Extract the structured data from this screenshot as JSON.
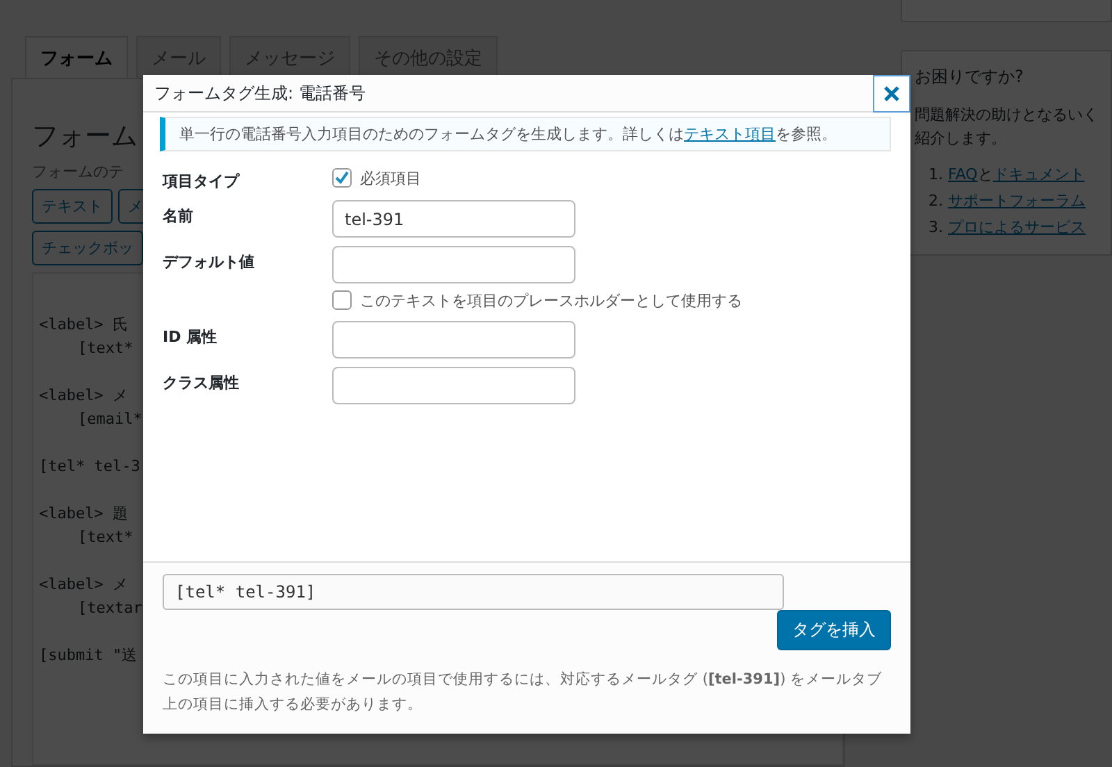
{
  "tabs": [
    {
      "label": "フォーム",
      "selected": true
    },
    {
      "label": "メール",
      "selected": false
    },
    {
      "label": "メッセージ",
      "selected": false
    },
    {
      "label": "その他の設定",
      "selected": false
    }
  ],
  "form_panel": {
    "title": "フォーム",
    "description": "フォームのテ",
    "tag_buttons": [
      [
        "テキスト",
        "メ"
      ],
      [
        "チェックボッ"
      ]
    ],
    "code_blocks": [
      {
        "line": "<label> 氏",
        "inner": "[text*"
      },
      {
        "line": "<label> メ",
        "inner": "[email*"
      },
      {
        "line": "[tel* tel-3"
      },
      {
        "line": "<label> 題",
        "inner": "[text*"
      },
      {
        "line": "<label> メ",
        "inner": "[textar"
      },
      {
        "line": "[submit \"送"
      }
    ]
  },
  "sidebar": {
    "title": "お困りですか?",
    "text_lines": [
      "問題解決の助けとなるいく",
      "紹介します。"
    ],
    "links": [
      {
        "number": "1.",
        "segments": [
          {
            "text": "FAQ",
            "link": true
          },
          {
            "text": "と",
            "link": false
          },
          {
            "text": "ドキュメント",
            "link": true
          }
        ]
      },
      {
        "number": "2.",
        "segments": [
          {
            "text": "サポートフォーラム",
            "link": true
          }
        ]
      },
      {
        "number": "3.",
        "segments": [
          {
            "text": "プロによるサービス",
            "link": true
          }
        ]
      }
    ]
  },
  "dialog": {
    "title": "フォームタグ生成: 電話番号",
    "notice": {
      "before": "単一行の電話番号入力項目のためのフォームタグを生成します。詳しくは",
      "link": "テキスト項目",
      "after": "を参照。"
    },
    "fields": [
      {
        "kind": "checkbox",
        "label": "項目タイプ",
        "option": "必須項目",
        "checked": true
      },
      {
        "kind": "text",
        "label": "名前",
        "value": "tel-391"
      },
      {
        "kind": "text_option",
        "label": "デフォルト値",
        "option": "このテキストを項目のプレースホルダーとして使用する",
        "checked": false
      },
      {
        "kind": "text",
        "label": "ID 属性"
      },
      {
        "kind": "text",
        "label": "クラス属性"
      }
    ],
    "tag_value": "[tel* tel-391]",
    "insert_button": "タグを挿入",
    "note": "この項目に入力された値をメールの項目で使用するには、対応するメールタグ (**[tel-391]**) をメールタブ上の項目に挿入する必要があります。"
  }
}
